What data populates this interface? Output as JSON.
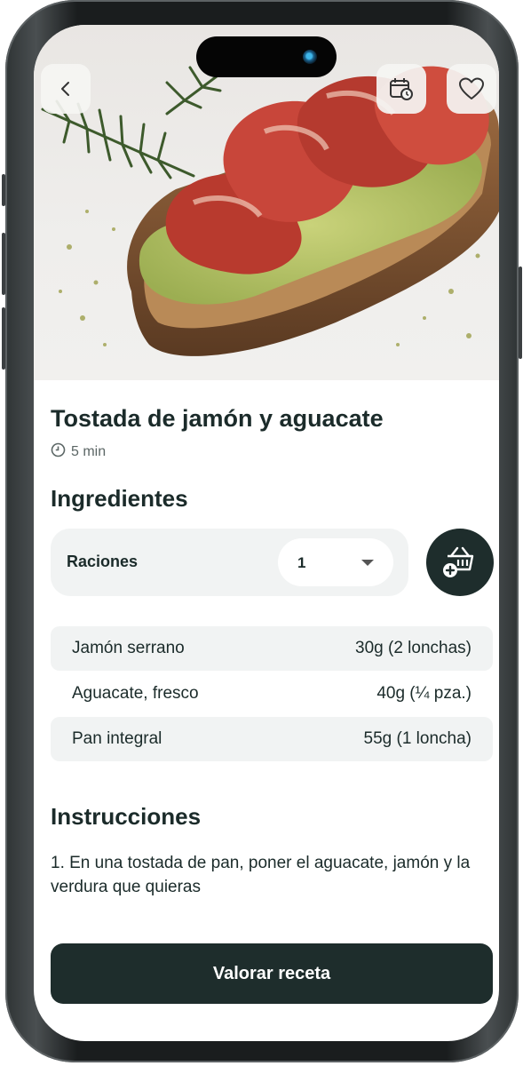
{
  "recipe": {
    "title": "Tostada de jamón y aguacate",
    "time": "5 min",
    "image_alt": "tostada-photo"
  },
  "ingredients_section": {
    "heading": "Ingredientes",
    "servings_label": "Raciones",
    "servings_value": "1",
    "items": [
      {
        "name": "Jamón serrano",
        "amount": "30g (2 lonchas)"
      },
      {
        "name": "Aguacate, fresco",
        "amount": "40g (¼ pza.)"
      },
      {
        "name": "Pan integral",
        "amount": "55g (1 loncha)"
      }
    ]
  },
  "instructions_section": {
    "heading": "Instrucciones",
    "text": "1. En una tostada de pan, poner el aguacate, jamón y la verdura que quieras"
  },
  "actions": {
    "rate_label": "Valorar receta"
  },
  "icons": {
    "back": "chevron-left-icon",
    "calendar": "calendar-clock-icon",
    "favorite": "heart-icon",
    "time": "clock-icon",
    "add_cart": "basket-plus-icon"
  },
  "colors": {
    "primary": "#1e2d2c",
    "surface": "#f1f3f3",
    "text": "#1b2b2a"
  }
}
